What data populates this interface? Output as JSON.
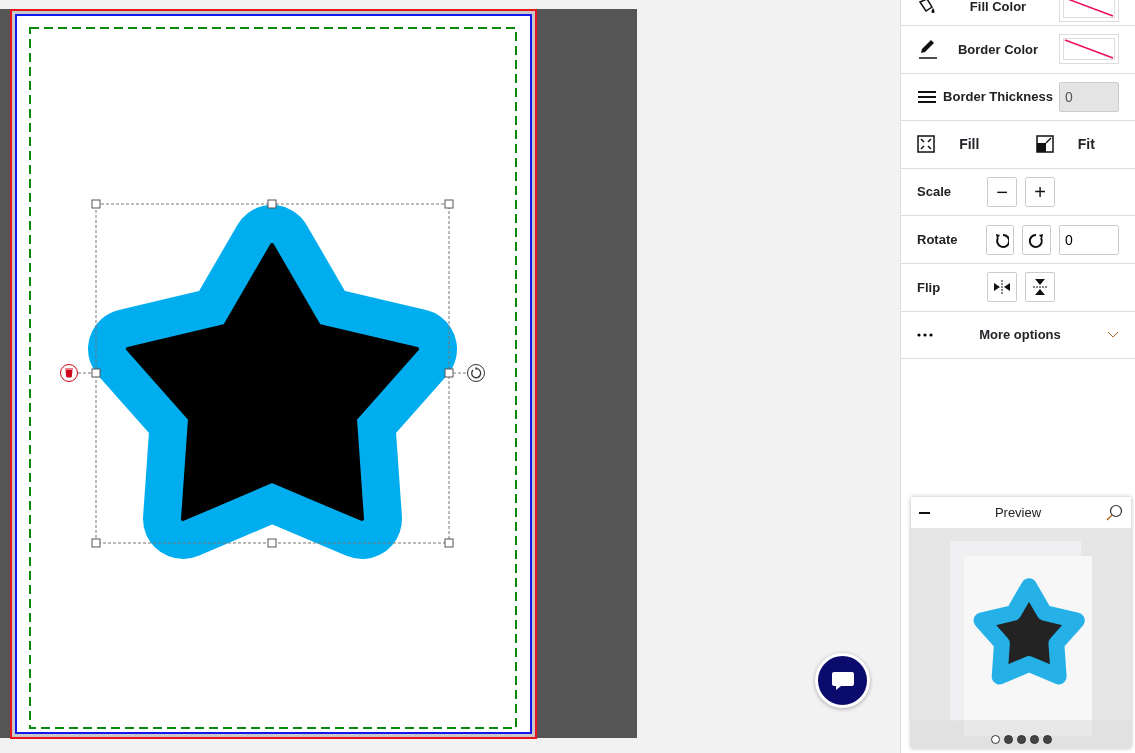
{
  "panel": {
    "rows": [
      {
        "kind": "swatch",
        "label": "Fill Color"
      },
      {
        "kind": "swatch",
        "label": "Border Color"
      },
      {
        "kind": "number",
        "label": "Border Thickness",
        "value": "0",
        "disabled": true
      },
      {
        "kind": "pair",
        "options": [
          {
            "label": "Fill"
          },
          {
            "label": "Fit"
          }
        ]
      },
      {
        "kind": "scale",
        "label": "Scale",
        "minus": "−",
        "plus": "+"
      },
      {
        "kind": "rotate",
        "label": "Rotate",
        "value": "0"
      },
      {
        "kind": "flip",
        "label": "Flip"
      },
      {
        "kind": "more",
        "label": "More options",
        "expanded": false
      }
    ]
  },
  "preview": {
    "title": "Preview",
    "dots": [
      {
        "selected": true
      },
      {
        "selected": false
      },
      {
        "selected": false
      },
      {
        "selected": false
      },
      {
        "selected": false
      }
    ]
  }
}
